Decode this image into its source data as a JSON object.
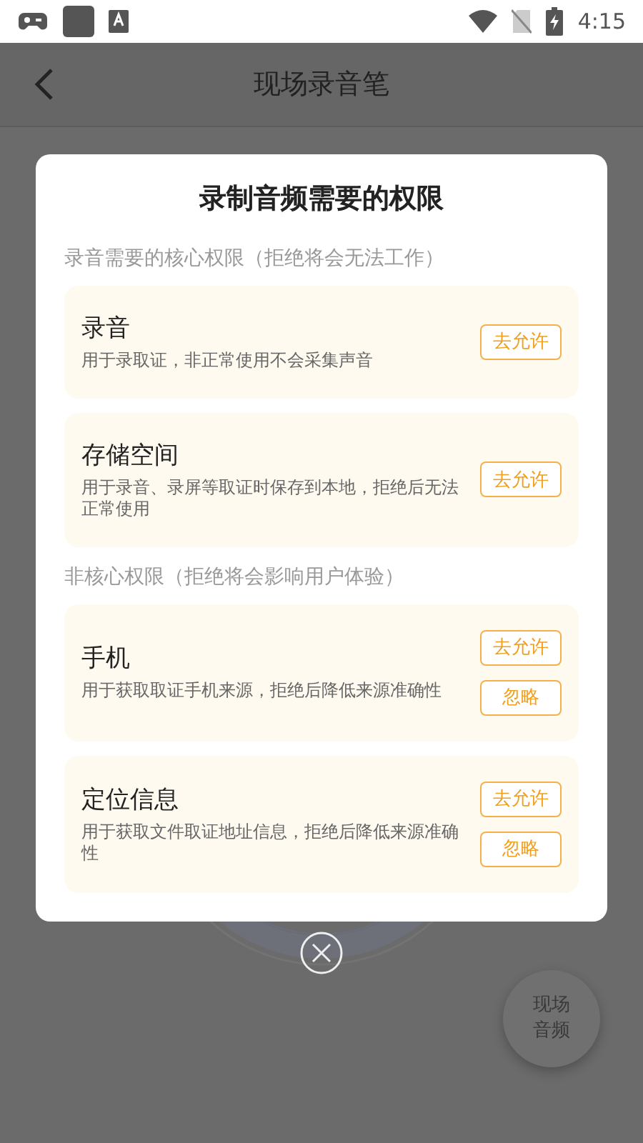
{
  "status_bar": {
    "time": "4:15"
  },
  "header": {
    "title": "现场录音笔"
  },
  "dialog": {
    "title": "录制音频需要的权限",
    "sections": [
      {
        "heading": "录音需要的核心权限（拒绝将会无法工作）",
        "items": [
          {
            "name": "录音",
            "description": "用于录取证，非正常使用不会采集声音",
            "buttons": [
              "去允许"
            ]
          },
          {
            "name": "存储空间",
            "description": "用于录音、录屏等取证时保存到本地，拒绝后无法正常使用",
            "buttons": [
              "去允许"
            ]
          }
        ]
      },
      {
        "heading": "非核心权限（拒绝将会影响用户体验）",
        "items": [
          {
            "name": "手机",
            "description": "用于获取取证手机来源，拒绝后降低来源准确性",
            "buttons": [
              "去允许",
              "忽略"
            ]
          },
          {
            "name": "定位信息",
            "description": "用于获取文件取证地址信息，拒绝后降低来源准确性",
            "buttons": [
              "去允许",
              "忽略"
            ]
          }
        ]
      }
    ]
  },
  "float_button": {
    "label": "现场音频"
  }
}
